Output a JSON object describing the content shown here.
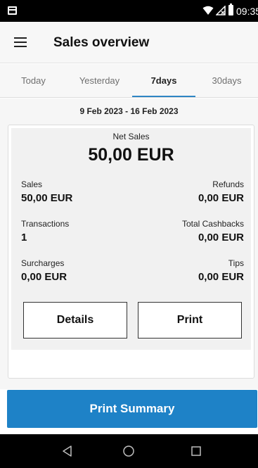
{
  "status_bar": {
    "time": "09:35",
    "icons": [
      "app-notification-icon",
      "wifi-icon",
      "signal-icon",
      "battery-icon"
    ]
  },
  "app_bar": {
    "title": "Sales overview",
    "menu_icon": "hamburger-menu-icon"
  },
  "tabs": [
    {
      "label": "Today",
      "active": false
    },
    {
      "label": "Yesterday",
      "active": false
    },
    {
      "label": "7days",
      "active": true
    },
    {
      "label": "30days",
      "active": false
    }
  ],
  "date_range": "9 Feb 2023 - 16 Feb 2023",
  "summary": {
    "net_sales_label": "Net Sales",
    "net_sales_value": "50,00 EUR",
    "sales_label": "Sales",
    "sales_value": "50,00 EUR",
    "refunds_label": "Refunds",
    "refunds_value": "0,00 EUR",
    "transactions_label": "Transactions",
    "transactions_value": "1",
    "cashbacks_label": "Total Cashbacks",
    "cashbacks_value": "0,00 EUR",
    "surcharges_label": "Surcharges",
    "surcharges_value": "0,00 EUR",
    "tips_label": "Tips",
    "tips_value": "0,00 EUR"
  },
  "buttons": {
    "details": "Details",
    "print": "Print",
    "print_summary": "Print Summary"
  },
  "colors": {
    "accent": "#1e82c7",
    "tab_indicator": "#2f86c4"
  },
  "nav_bar": {
    "icons": [
      "back-icon",
      "home-icon",
      "recent-apps-icon"
    ]
  }
}
